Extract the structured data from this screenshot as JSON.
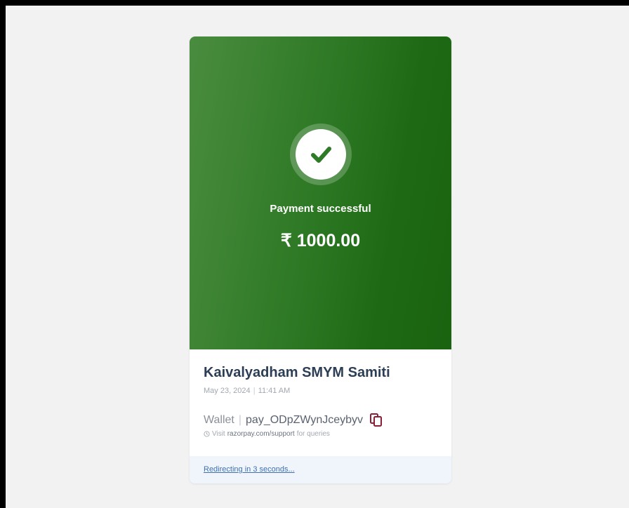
{
  "payment": {
    "status": "Payment successful",
    "amount": "₹ 1000.00"
  },
  "merchant": {
    "name": "Kaivalyadham SMYM Samiti",
    "date": "May 23, 2024",
    "separator": "|",
    "time": "11:41 AM"
  },
  "transaction": {
    "method": "Wallet",
    "separator": "|",
    "payment_id": "pay_ODpZWynJceybyv"
  },
  "support": {
    "prefix": "Visit",
    "link": "razorpay.com/support",
    "suffix": "for queries"
  },
  "footer": {
    "redirect_text": "Redirecting in 3 seconds..."
  },
  "icons": {
    "success": "check-icon",
    "copy": "copy-icon",
    "support": "clock-icon"
  },
  "colors": {
    "success_green": "#2f7a26",
    "merchant_text": "#2c3e55",
    "copy_icon": "#8a1f35",
    "link_blue": "#3f6fb0"
  }
}
